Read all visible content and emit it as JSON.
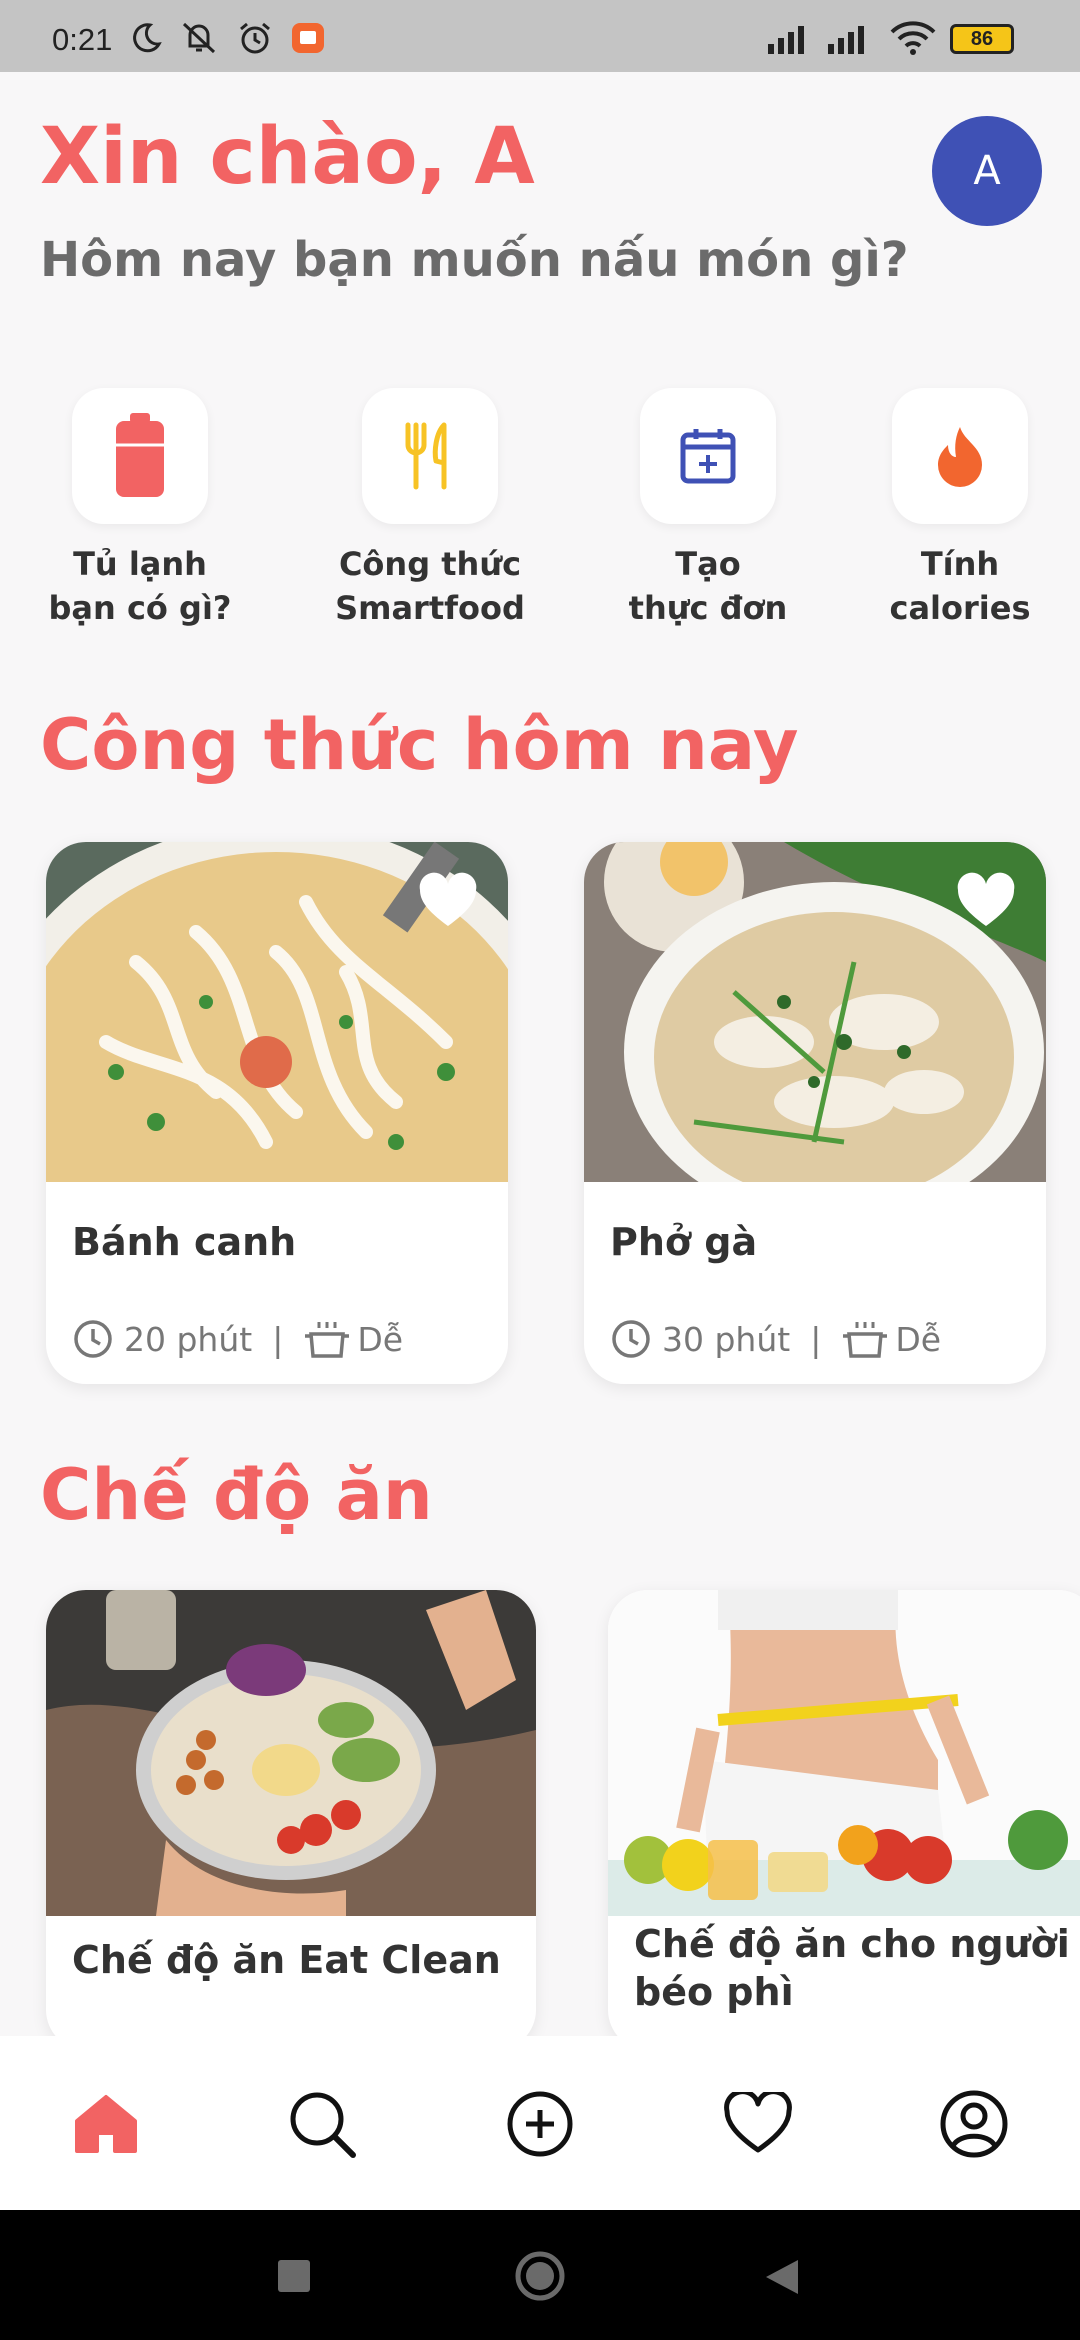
{
  "status_bar": {
    "time": "0:21",
    "battery": "86"
  },
  "header": {
    "greeting": "Xin chào, A",
    "subtitle": "Hôm nay bạn muốn nấu món gì?",
    "avatar_letter": "A"
  },
  "quick_actions": [
    {
      "label": "Tủ lạnh\nbạn có gì?",
      "icon": "fridge-icon",
      "color": "#f26363"
    },
    {
      "label": "Công thức\nSmartfood",
      "icon": "fork-knife-icon",
      "color": "#f7c325"
    },
    {
      "label": "Tạo\nthực đơn",
      "icon": "calendar-add-icon",
      "color": "#3f51b5"
    },
    {
      "label": "Tính\ncalories",
      "icon": "flame-icon",
      "color": "#f2662f"
    }
  ],
  "sections": {
    "today_recipes": "Công thức hôm nay",
    "diets": "Chế độ ăn"
  },
  "recipes": [
    {
      "title": "Bánh canh",
      "time": "20 phút",
      "difficulty": "Dễ"
    },
    {
      "title": "Phở gà",
      "time": "30 phút",
      "difficulty": "Dễ"
    }
  ],
  "diets": [
    {
      "title": "Chế độ ăn Eat Clean"
    },
    {
      "title": "Chế độ ăn cho người béo phì"
    }
  ],
  "bottom_nav": [
    "home-icon",
    "search-icon",
    "add-icon",
    "heart-icon",
    "profile-icon"
  ],
  "colors": {
    "accent": "#f26363",
    "avatar": "#3f51b5"
  }
}
